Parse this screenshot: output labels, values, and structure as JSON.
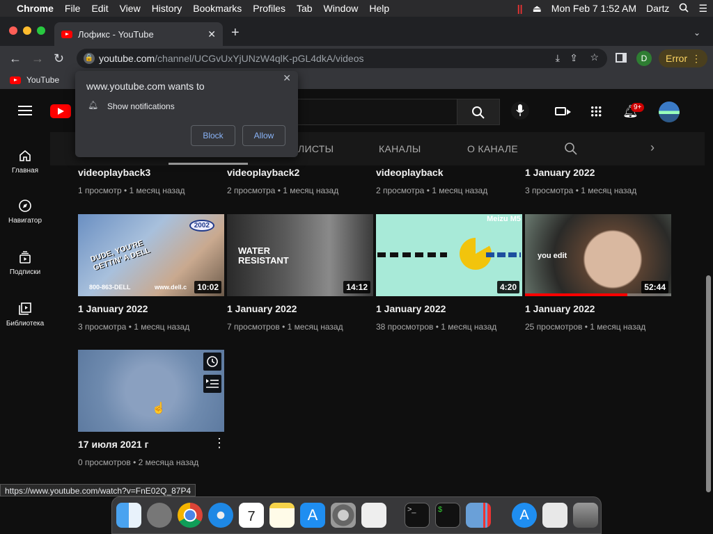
{
  "menubar": {
    "app": "Chrome",
    "items": [
      "File",
      "Edit",
      "View",
      "History",
      "Bookmarks",
      "Profiles",
      "Tab",
      "Window",
      "Help"
    ],
    "datetime": "Mon Feb 7  1:52 AM",
    "user": "Dartz"
  },
  "browser": {
    "tab_title": "Лофикс - YouTube",
    "url_host": "youtube.com",
    "url_path": "/channel/UCGvUxYjUNzW4qlK-pGL4dkA/videos",
    "error_label": "Error",
    "profile_initial": "D",
    "bookmark_label": "YouTube",
    "status_url": "https://www.youtube.com/watch?v=FnE02Q_87P4"
  },
  "popup": {
    "title": "www.youtube.com wants to",
    "permission": "Show notifications",
    "block_label": "Block",
    "allow_label": "Allow"
  },
  "youtube": {
    "notif_count": "9+",
    "sidebar": [
      {
        "label": "Главная",
        "icon": "home-icon"
      },
      {
        "label": "Навигатор",
        "icon": "compass-icon"
      },
      {
        "label": "Подписки",
        "icon": "subscriptions-icon"
      },
      {
        "label": "Библиотека",
        "icon": "library-icon"
      }
    ],
    "tabs": [
      "ЛИСТЫ",
      "КАНАЛЫ",
      "О КАНАЛЕ"
    ],
    "row0": [
      {
        "title": "videoplayback3",
        "meta": "1 просмотр • 1 месяц назад"
      },
      {
        "title": "videoplayback2",
        "meta": "2 просмотра • 1 месяц назад"
      },
      {
        "title": "videoplayback",
        "meta": "2 просмотра • 1 месяц назад"
      },
      {
        "title": "1 January 2022",
        "meta": "3 просмотра • 1 месяц назад"
      }
    ],
    "row1": [
      {
        "title": "1 January 2022",
        "meta": "3 просмотра • 1 месяц назад",
        "duration": "10:02",
        "thumb_text": "DUDE, YOU'RE GETTIN' A DELL",
        "thumb_sub": "800-863-DELL",
        "thumb_badge": "2002",
        "thumb_url": "www.dell.c"
      },
      {
        "title": "1 January 2022",
        "meta": "7 просмотров • 1 месяц назад",
        "duration": "14:12",
        "thumb_text": "WATER RESISTANT"
      },
      {
        "title": "1 January 2022",
        "meta": "38 просмотров • 1 месяц назад",
        "duration": "4:20",
        "thumb_text": "Meizu M5"
      },
      {
        "title": "1 January 2022",
        "meta": "25 просмотров • 1 месяц назад",
        "duration": "52:44",
        "thumb_text": "you edit",
        "progress": 0.7
      }
    ],
    "row2": [
      {
        "title": "17 июля 2021 г",
        "meta": "0 просмотров • 2 месяца назад"
      }
    ]
  }
}
